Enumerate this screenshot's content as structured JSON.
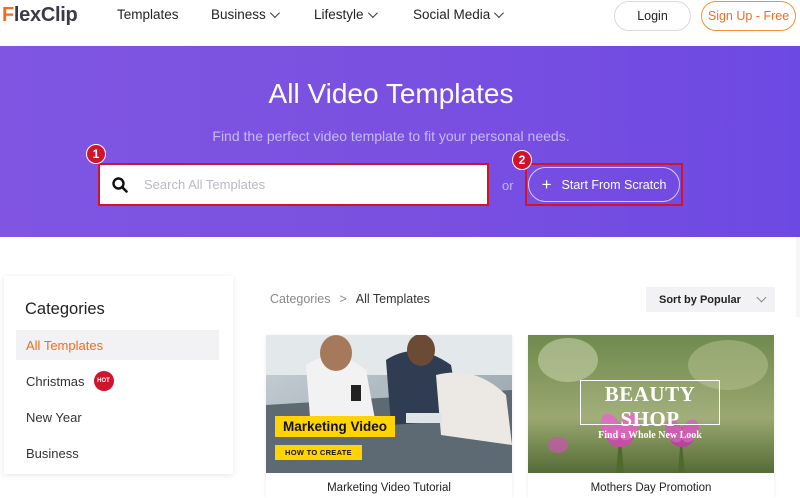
{
  "brand": {
    "name_head": "F",
    "name_rest": "lexClip",
    "accent": "#f26b21"
  },
  "nav": {
    "items": [
      {
        "label": "Templates",
        "has_dropdown": false
      },
      {
        "label": "Business",
        "has_dropdown": true
      },
      {
        "label": "Lifestyle",
        "has_dropdown": true
      },
      {
        "label": "Social Media",
        "has_dropdown": true
      }
    ],
    "login_label": "Login",
    "signup_label": "Sign Up - Free"
  },
  "hero": {
    "title": "All Video Templates",
    "subtitle": "Find the perfect video template to fit your personal needs.",
    "search_placeholder": "Search All Templates",
    "search_value": "",
    "or_text": "or",
    "scratch_label": "Start From Scratch",
    "step_badges": [
      "1",
      "2"
    ],
    "background": "#7a50e0",
    "highlight_color": "#d0142c"
  },
  "categories": {
    "title": "Categories",
    "items": [
      {
        "label": "All Templates",
        "active": true,
        "badge": ""
      },
      {
        "label": "Christmas",
        "active": false,
        "badge": "HOT"
      },
      {
        "label": "New Year",
        "active": false,
        "badge": ""
      },
      {
        "label": "Business",
        "active": false,
        "badge": ""
      }
    ]
  },
  "breadcrumb": {
    "root": "Categories",
    "separator": ">",
    "current": "All Templates"
  },
  "sort": {
    "label": "Sort by Popular"
  },
  "templates": [
    {
      "name": "Marketing Video Tutorial",
      "thumb_title": "Marketing Video",
      "thumb_subtitle": "HOW TO CREATE"
    },
    {
      "name": "Mothers Day Promotion",
      "thumb_title": "BEAUTY SHOP",
      "thumb_subtitle": "Find a Whole New Look"
    }
  ]
}
